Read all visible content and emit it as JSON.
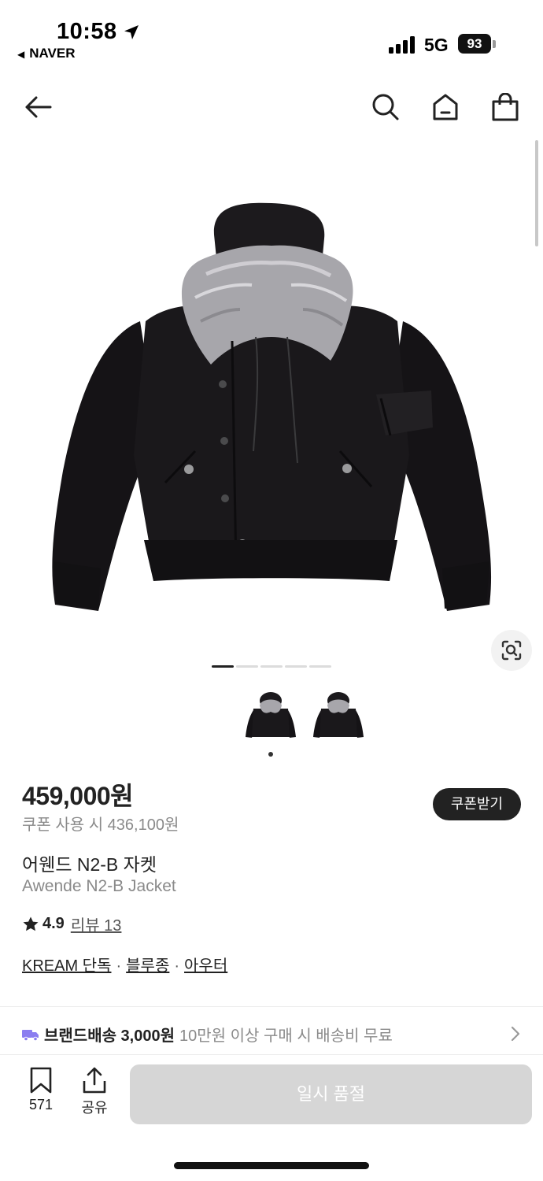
{
  "status_bar": {
    "time": "10:58",
    "back_app": "NAVER",
    "network": "5G",
    "battery": "93"
  },
  "nav": {
    "icons": [
      "back-arrow-icon",
      "search-icon",
      "home-icon",
      "shopping-bag-icon"
    ]
  },
  "gallery": {
    "page_count": 5,
    "active_page": 1,
    "thumbnail_count": 2,
    "active_thumbnail": 1
  },
  "product": {
    "price": "459,000원",
    "coupon_price": "쿠폰 사용 시 436,100원",
    "coupon_button": "쿠폰받기",
    "name_ko": "어웬드 N2-B 자켓",
    "name_en": "Awende N2-B Jacket",
    "rating": "4.9",
    "review_label": "리뷰 13",
    "tags": [
      "KREAM 단독",
      "블루종",
      "아우터"
    ]
  },
  "delivery": {
    "main": "브랜드배송 3,000원",
    "sub": "10만원 이상 구매 시 배송비 무료"
  },
  "bottom": {
    "save_count": "571",
    "share_label": "공유",
    "cta_label": "일시 품절"
  },
  "colors": {
    "accent_truck": "#8a7df0",
    "cta_disabled": "#d6d6d6"
  }
}
